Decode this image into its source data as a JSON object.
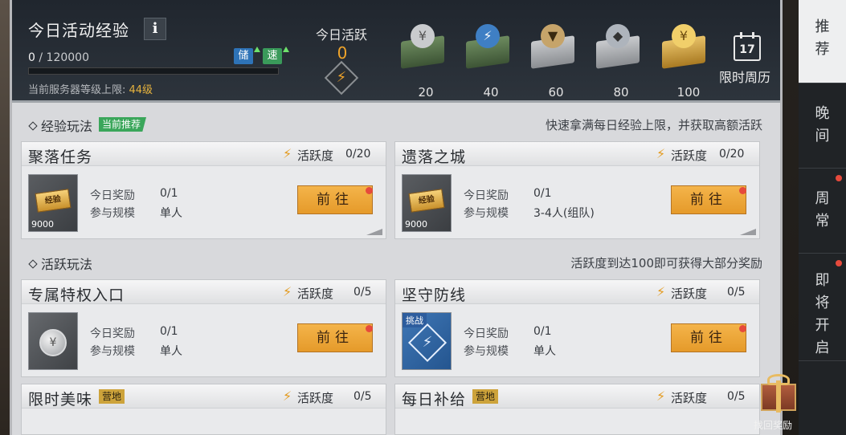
{
  "header": {
    "title": "今日活动经验",
    "info_label": "i",
    "xp_current": "0",
    "xp_max": " / 120000",
    "xp_progress": 0,
    "badge_store": "储",
    "badge_speed": "速",
    "cap_prefix": "当前服务器等级上限: ",
    "cap_level": "44级",
    "today_label": "今日活跃",
    "today_value": "0",
    "milestones": [
      "20",
      "40",
      "60",
      "80",
      "100"
    ],
    "calendar_day": "17",
    "calendar_label": "限时周历"
  },
  "sections": {
    "exp": {
      "title": "经验玩法",
      "tag": "当前推荐",
      "desc": "快速拿满每日经验上限，并获取高额活跃"
    },
    "active": {
      "title": "活跃玩法",
      "desc": "活跃度到达100即可获得大部分奖励"
    }
  },
  "common": {
    "activity_label": "活跃度",
    "reward_label": "今日奖励",
    "scale_label": "参与规模",
    "go_label": "前往",
    "exp_ticket": "经验",
    "exp_qty": "9000",
    "challenge": "挑战"
  },
  "cards": [
    {
      "name": "聚落任务",
      "activity": "0/20",
      "reward": "0/1",
      "scale": "单人"
    },
    {
      "name": "遗落之城",
      "activity": "0/20",
      "reward": "0/1",
      "scale": "3-4人(组队)"
    },
    {
      "name": "专属特权入口",
      "activity": "0/5",
      "reward": "0/1",
      "scale": "单人"
    },
    {
      "name": "坚守防线",
      "activity": "0/5",
      "reward": "0/1",
      "scale": "单人"
    },
    {
      "name": "限时美味",
      "tag": "营地",
      "activity": "0/5"
    },
    {
      "name": "每日补给",
      "tag": "营地",
      "activity": "0/5"
    }
  ],
  "sidebar": {
    "tabs": [
      "推荐",
      "晚间",
      "周常",
      "即将开启"
    ]
  },
  "gift": {
    "label": "找回奖励"
  },
  "colors": {
    "accent": "#e59a2a",
    "active_gold": "#f0a42a",
    "alert_red": "#e64a3c",
    "tag_green": "#3aa65a"
  }
}
